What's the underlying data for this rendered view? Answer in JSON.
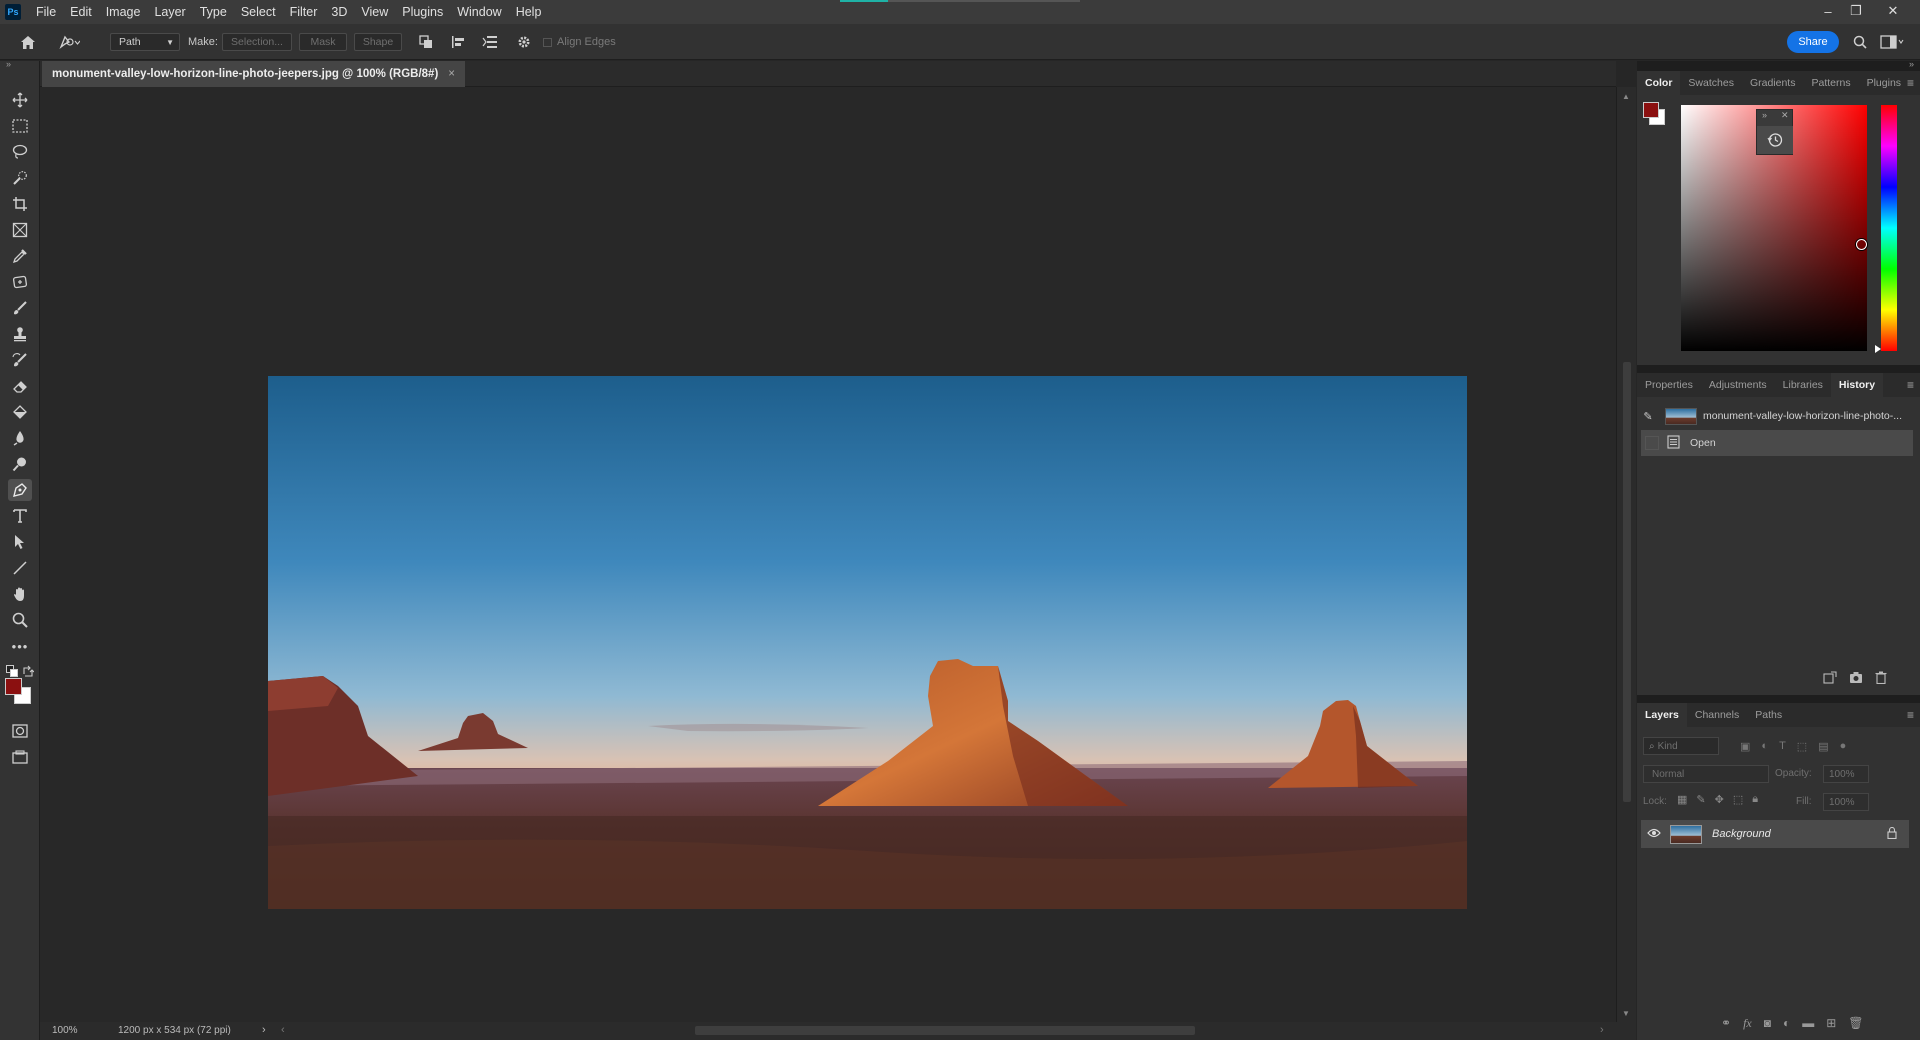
{
  "app": {
    "logo": "Ps",
    "menu": [
      "File",
      "Edit",
      "Image",
      "Layer",
      "Type",
      "Select",
      "Filter",
      "3D",
      "View",
      "Plugins",
      "Window",
      "Help"
    ],
    "window_controls": {
      "minimize": "–",
      "restore": "❐",
      "close": "✕"
    }
  },
  "options_bar": {
    "tool_mode": "Path",
    "make_label": "Make:",
    "selection_btn": "Selection...",
    "mask_btn": "Mask",
    "shape_btn": "Shape",
    "align_edges": "Align Edges",
    "share": "Share"
  },
  "document": {
    "tab_title": "monument-valley-low-horizon-line-photo-jeepers.jpg @ 100% (RGB/8#)",
    "zoom": "100%",
    "dimensions": "1200 px x 534 px (72 ppi)"
  },
  "color_panel": {
    "tabs": [
      "Color",
      "Swatches",
      "Gradients",
      "Patterns",
      "Plugins"
    ],
    "active_tab": "Color",
    "foreground": "#8b1010",
    "background": "#ffffff",
    "hue": "#ff0000"
  },
  "properties_panel": {
    "tabs": [
      "Properties",
      "Adjustments",
      "Libraries",
      "History"
    ],
    "active_tab": "History",
    "history": [
      {
        "label": "monument-valley-low-horizon-line-photo-..."
      },
      {
        "label": "Open"
      }
    ]
  },
  "layers_panel": {
    "tabs": [
      "Layers",
      "Channels",
      "Paths"
    ],
    "active_tab": "Layers",
    "kind_placeholder": "Kind",
    "blend_mode": "Normal",
    "opacity_label": "Opacity:",
    "opacity_value": "100%",
    "lock_label": "Lock:",
    "fill_label": "Fill:",
    "fill_value": "100%",
    "layers": [
      {
        "name": "Background"
      }
    ]
  }
}
